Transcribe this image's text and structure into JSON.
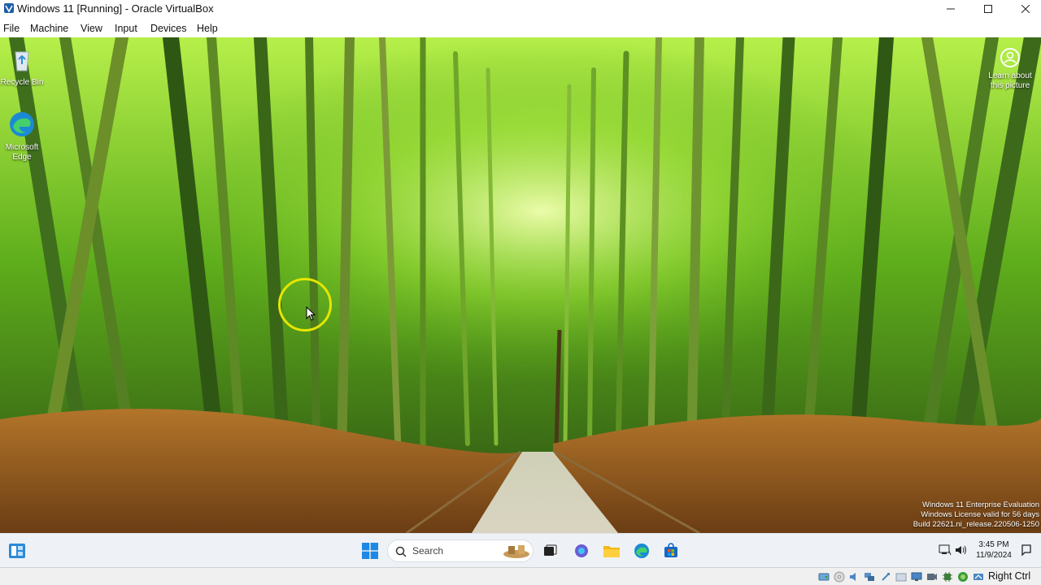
{
  "window": {
    "title": "Windows 11 [Running] - Oracle VirtualBox",
    "icons": [
      "virtualbox-icon",
      "minimize-icon",
      "maximize-icon",
      "close-icon"
    ]
  },
  "menu": [
    "File",
    "Machine",
    "View",
    "Input",
    "Devices",
    "Help"
  ],
  "desktop": {
    "icons": [
      {
        "label": "Recycle Bin",
        "icon": "recycle-bin-icon"
      },
      {
        "label": "Microsoft Edge",
        "icon": "edge-icon"
      }
    ],
    "learn_label": "Learn about this picture",
    "watermark": [
      "Windows 11 Enterprise Evaluation",
      "Windows License valid for 56 days",
      "Build 22621.ni_release.220506-1250"
    ]
  },
  "taskbar": {
    "search_placeholder": "Search",
    "pinned": [
      "widgets-icon",
      "start-icon",
      "search-icon",
      "task-view-icon",
      "copilot-icon",
      "file-explorer-icon",
      "edge-icon",
      "store-icon"
    ],
    "time": "3:45 PM",
    "date": "11/9/2024"
  },
  "statusbar": {
    "host_key": "Right Ctrl",
    "icons": [
      "hard-disk-icon",
      "optical-drive-icon",
      "audio-icon",
      "network-icon",
      "usb-icon",
      "shared-folder-icon",
      "display-icon",
      "recording-icon",
      "cpu-icon",
      "mouse-integration-icon",
      "keyboard-icon"
    ]
  },
  "colors": {
    "accent": "#0078d4",
    "cursor_ring": "#e6e600"
  }
}
